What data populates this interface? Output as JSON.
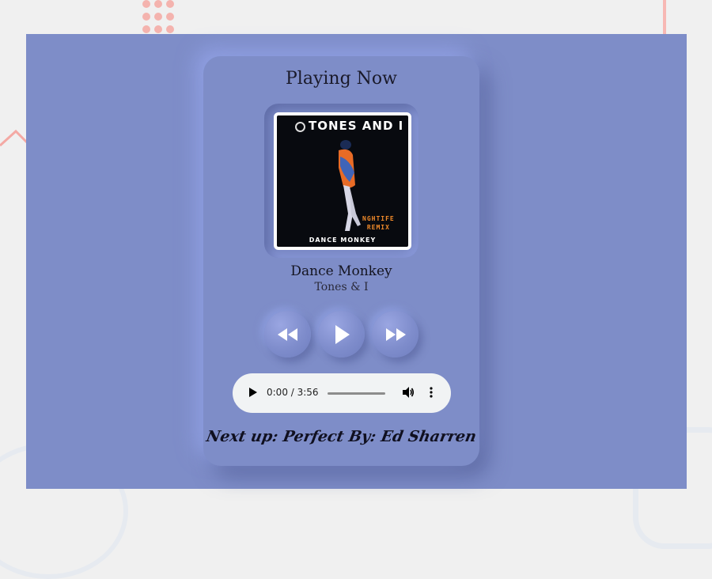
{
  "player": {
    "heading": "Playing Now",
    "album_art": {
      "artist_text": "TONES AND I",
      "remix_text_line1": "NGHTIFE",
      "remix_text_line2": "REMIX",
      "song_text": "DANCE MONKEY"
    },
    "song_title": "Dance Monkey",
    "song_artist": "Tones & I",
    "controls": {
      "rewind_icon": "rewind-icon",
      "play_icon": "play-icon",
      "forward_icon": "fast-forward-icon"
    },
    "audio": {
      "time": "0:00 / 3:56",
      "progress": 0.0,
      "play_icon": "play-icon",
      "volume_icon": "volume-icon",
      "more_icon": "more-vertical-icon"
    },
    "next_up": "Next up: Perfect By: Ed Sharren"
  },
  "colors": {
    "background": "#7e8dc8",
    "page": "#f0f0f0",
    "audio_bar": "#f1f3f4"
  }
}
